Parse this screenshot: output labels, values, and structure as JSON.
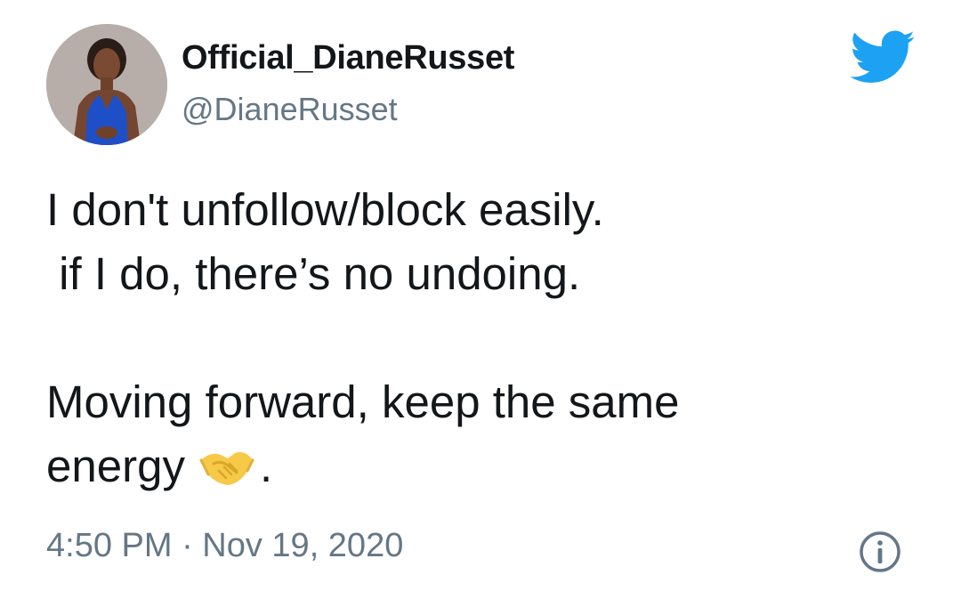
{
  "user": {
    "display_name": "Official_DianeRusset",
    "handle": "@DianeRusset",
    "avatar_icon": "profile-photo"
  },
  "tweet": {
    "line1": "I don't unfollow/block easily.",
    "line2": " if I do, there’s no undoing.",
    "line3": "Moving forward, keep the same",
    "line4_prefix": "energy",
    "line4_suffix": ".",
    "emoji_icon": "handshake-emoji",
    "timestamp": "4:50 PM · Nov 19, 2020"
  },
  "icons": {
    "brand": "twitter-bird-icon",
    "info": "info-icon"
  },
  "colors": {
    "twitter_blue": "#1da1f2",
    "text_primary": "#14171a",
    "text_secondary": "#657786",
    "emoji_yellow": "#f7c948"
  }
}
